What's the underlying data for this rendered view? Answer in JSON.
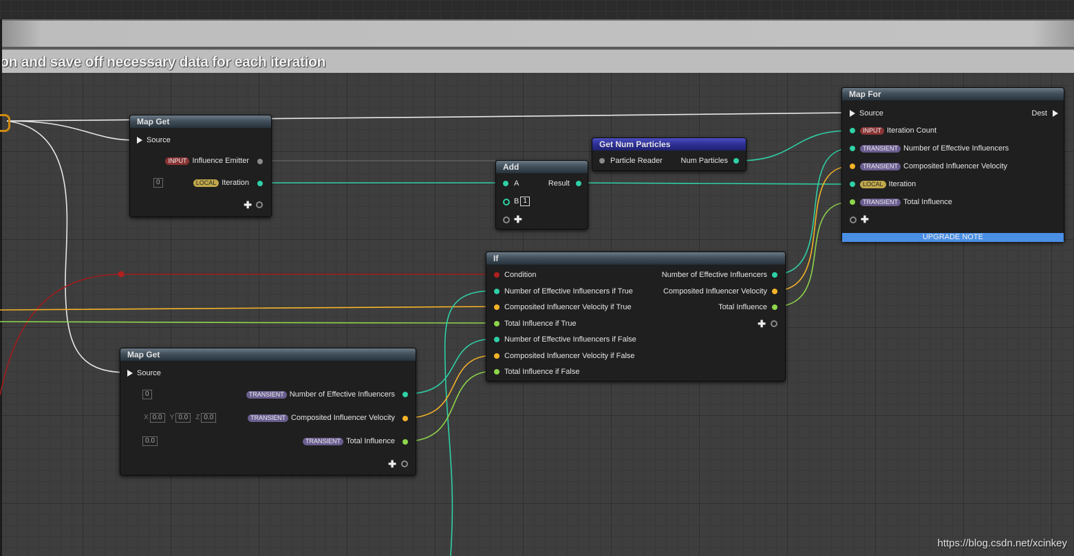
{
  "comment": {
    "text": "on and save off necessary data for each iteration"
  },
  "map_get_top": {
    "title": "Map Get",
    "source": "Source",
    "input_badge": "INPUT",
    "influence_emitter": "Influence Emitter",
    "iteration_default": "0",
    "local_badge": "LOCAL",
    "iteration": "Iteration"
  },
  "add_node": {
    "title": "Add",
    "a": "A",
    "result": "Result",
    "b": "B",
    "b_default": "1"
  },
  "get_num_particles": {
    "title": "Get Num Particles",
    "particle_reader": "Particle Reader",
    "num_particles": "Num Particles"
  },
  "map_for": {
    "title": "Map For",
    "source": "Source",
    "dest": "Dest",
    "input_badge": "INPUT",
    "iteration_count": "Iteration Count",
    "transient_badge": "TRANSIENT",
    "num_effective": "Number of Effective Influencers",
    "composited_velocity": "Composited Influencer Velocity",
    "local_badge": "LOCAL",
    "iteration": "Iteration",
    "total_influence": "Total Influence",
    "upgrade_note": "UPGRADE NOTE"
  },
  "if_node": {
    "title": "If",
    "condition": "Condition",
    "in_num_true": "Number of Effective Influencers if True",
    "in_vel_true": "Composited Influencer Velocity if True",
    "in_total_true": "Total Influence if True",
    "in_num_false": "Number of Effective Influencers if False",
    "in_vel_false": "Composited Influencer Velocity if False",
    "in_total_false": "Total Influence if False",
    "out_num": "Number of Effective Influencers",
    "out_vel": "Composited Influencer Velocity",
    "out_total": "Total Influence"
  },
  "map_get_bottom": {
    "title": "Map Get",
    "source": "Source",
    "num_default": "0",
    "transient_badge": "TRANSIENT",
    "num_effective": "Number of Effective Influencers",
    "x_label": "X",
    "x_val": "0.0",
    "y_label": "Y",
    "y_val": "0.0",
    "z_label": "Z",
    "z_val": "0.0",
    "composited_velocity": "Composited Influencer Velocity",
    "total_default": "0.0",
    "total_influence": "Total Influence"
  },
  "watermark": "https://blog.csdn.net/xcinkey",
  "colors": {
    "teal": "#2fd0a6",
    "orange": "#f5b428",
    "lime": "#8ed64a",
    "red": "#b02020",
    "upgrade": "#4a8fe6"
  }
}
